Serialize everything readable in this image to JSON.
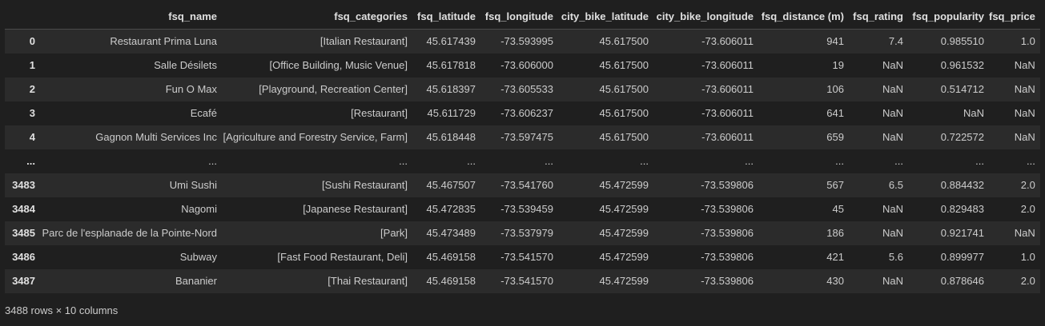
{
  "columns": [
    "fsq_name",
    "fsq_categories",
    "fsq_latitude",
    "fsq_longitude",
    "city_bike_latitude",
    "city_bike_longitude",
    "fsq_distance (m)",
    "fsq_rating",
    "fsq_popularity",
    "fsq_price"
  ],
  "rows": [
    {
      "index": "0",
      "cells": [
        "Restaurant Prima Luna",
        "[Italian Restaurant]",
        "45.617439",
        "-73.593995",
        "45.617500",
        "-73.606011",
        "941",
        "7.4",
        "0.985510",
        "1.0"
      ]
    },
    {
      "index": "1",
      "cells": [
        "Salle Désilets",
        "[Office Building, Music Venue]",
        "45.617818",
        "-73.606000",
        "45.617500",
        "-73.606011",
        "19",
        "NaN",
        "0.961532",
        "NaN"
      ]
    },
    {
      "index": "2",
      "cells": [
        "Fun O Max",
        "[Playground, Recreation Center]",
        "45.618397",
        "-73.605533",
        "45.617500",
        "-73.606011",
        "106",
        "NaN",
        "0.514712",
        "NaN"
      ]
    },
    {
      "index": "3",
      "cells": [
        "Ecafé",
        "[Restaurant]",
        "45.611729",
        "-73.606237",
        "45.617500",
        "-73.606011",
        "641",
        "NaN",
        "NaN",
        "NaN"
      ]
    },
    {
      "index": "4",
      "cells": [
        "Gagnon Multi Services Inc",
        "[Agriculture and Forestry Service, Farm]",
        "45.618448",
        "-73.597475",
        "45.617500",
        "-73.606011",
        "659",
        "NaN",
        "0.722572",
        "NaN"
      ]
    },
    {
      "index": "...",
      "cells": [
        "...",
        "...",
        "...",
        "...",
        "...",
        "...",
        "...",
        "...",
        "...",
        "..."
      ]
    },
    {
      "index": "3483",
      "cells": [
        "Umi Sushi",
        "[Sushi Restaurant]",
        "45.467507",
        "-73.541760",
        "45.472599",
        "-73.539806",
        "567",
        "6.5",
        "0.884432",
        "2.0"
      ]
    },
    {
      "index": "3484",
      "cells": [
        "Nagomi",
        "[Japanese Restaurant]",
        "45.472835",
        "-73.539459",
        "45.472599",
        "-73.539806",
        "45",
        "NaN",
        "0.829483",
        "2.0"
      ]
    },
    {
      "index": "3485",
      "cells": [
        "Parc de l'esplanade de la Pointe-Nord",
        "[Park]",
        "45.473489",
        "-73.537979",
        "45.472599",
        "-73.539806",
        "186",
        "NaN",
        "0.921741",
        "NaN"
      ]
    },
    {
      "index": "3486",
      "cells": [
        "Subway",
        "[Fast Food Restaurant, Deli]",
        "45.469158",
        "-73.541570",
        "45.472599",
        "-73.539806",
        "421",
        "5.6",
        "0.899977",
        "1.0"
      ]
    },
    {
      "index": "3487",
      "cells": [
        "Bananier",
        "[Thai Restaurant]",
        "45.469158",
        "-73.541570",
        "45.472599",
        "-73.539806",
        "430",
        "NaN",
        "0.878646",
        "2.0"
      ]
    }
  ],
  "shape_text": "3488 rows × 10 columns",
  "colors": {
    "background": "#1f1f1f",
    "row_stripe": "#2b2b2b",
    "text": "#cccccc",
    "header_text": "#e0e0e0"
  }
}
